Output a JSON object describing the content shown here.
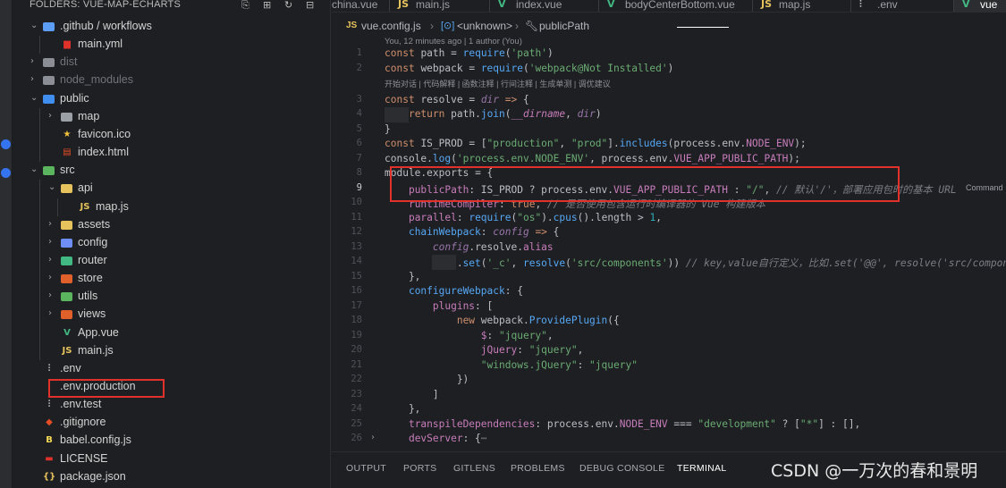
{
  "explorer": {
    "title": "FOLDERS: VUE-MAP-ECHARTS",
    "header_icons": [
      "new-file-icon",
      "new-folder-icon",
      "refresh-icon",
      "collapse-all-icon"
    ],
    "items": [
      {
        "label": ".github / workflows",
        "type": "folder",
        "open": true,
        "depth": 0,
        "dim": false
      },
      {
        "label": "main.yml",
        "type": "yml",
        "depth": 1,
        "dim": false
      },
      {
        "label": "dist",
        "type": "folder",
        "open": false,
        "depth": 0,
        "dim": true
      },
      {
        "label": "node_modules",
        "type": "folder",
        "open": false,
        "depth": 0,
        "dim": true
      },
      {
        "label": "public",
        "type": "folder",
        "open": true,
        "depth": 0,
        "dim": false
      },
      {
        "label": "map",
        "type": "folder",
        "open": false,
        "depth": 1,
        "dim": false
      },
      {
        "label": "favicon.ico",
        "type": "ico",
        "depth": 1,
        "dim": false
      },
      {
        "label": "index.html",
        "type": "html",
        "depth": 1,
        "dim": false
      },
      {
        "label": "src",
        "type": "folder",
        "open": true,
        "depth": 0,
        "dim": false
      },
      {
        "label": "api",
        "type": "folder",
        "open": true,
        "depth": 1,
        "dim": false
      },
      {
        "label": "map.js",
        "type": "js",
        "depth": 2,
        "dim": false
      },
      {
        "label": "assets",
        "type": "folder",
        "open": false,
        "depth": 1,
        "dim": false
      },
      {
        "label": "config",
        "type": "folder",
        "open": false,
        "depth": 1,
        "dim": false
      },
      {
        "label": "router",
        "type": "folder",
        "open": false,
        "depth": 1,
        "dim": false
      },
      {
        "label": "store",
        "type": "folder",
        "open": false,
        "depth": 1,
        "dim": false
      },
      {
        "label": "utils",
        "type": "folder",
        "open": false,
        "depth": 1,
        "dim": false
      },
      {
        "label": "views",
        "type": "folder",
        "open": false,
        "depth": 1,
        "dim": false
      },
      {
        "label": "App.vue",
        "type": "vue",
        "depth": 1,
        "dim": false
      },
      {
        "label": "main.js",
        "type": "js",
        "depth": 1,
        "dim": false
      },
      {
        "label": ".env",
        "type": "env",
        "depth": 0,
        "dim": false
      },
      {
        "label": ".env.production",
        "type": "env",
        "depth": 0,
        "dim": false
      },
      {
        "label": ".env.test",
        "type": "env",
        "depth": 0,
        "dim": false
      },
      {
        "label": ".gitignore",
        "type": "git",
        "depth": 0,
        "dim": false
      },
      {
        "label": "babel.config.js",
        "type": "babel",
        "depth": 0,
        "dim": false
      },
      {
        "label": "LICENSE",
        "type": "license",
        "depth": 0,
        "dim": false
      },
      {
        "label": "package.json",
        "type": "json",
        "depth": 0,
        "dim": false
      }
    ]
  },
  "tabs": [
    {
      "label": "china.vue",
      "icon": "vue-icon",
      "active": false
    },
    {
      "label": "main.js",
      "icon": "js-icon",
      "active": false
    },
    {
      "label": "index.vue",
      "icon": "vue-icon",
      "active": false
    },
    {
      "label": "bodyCenterBottom.vue",
      "icon": "vue-icon",
      "active": false
    },
    {
      "label": "map.js",
      "icon": "js-icon",
      "active": false
    },
    {
      "label": ".env",
      "icon": "env-icon",
      "active": false
    },
    {
      "label": "vue",
      "icon": "vue-icon",
      "active": true
    }
  ],
  "breadcrumb": {
    "file": "vue.config.js",
    "symbol1": "<unknown>",
    "symbol2": "publicPath"
  },
  "blame": "You, 12 minutes ago | 1 author (You)",
  "codelens": "开始对话 | 代码解释 | 函数注释 | 行间注释 | 生成单测 | 调优建议",
  "inline_hint": "Command",
  "current_line": 9,
  "line_numbers": [
    "1",
    "2",
    "3",
    "4",
    "5",
    "6",
    "7",
    "8",
    "9",
    "10",
    "11",
    "12",
    "13",
    "14",
    "15",
    "16",
    "17",
    "18",
    "19",
    "20",
    "21",
    "22",
    "23",
    "24",
    "25",
    "26"
  ],
  "panel_tabs": [
    {
      "label": "OUTPUT",
      "active": false
    },
    {
      "label": "PORTS",
      "active": false
    },
    {
      "label": "GITLENS",
      "active": false
    },
    {
      "label": "PROBLEMS",
      "active": false
    },
    {
      "label": "DEBUG CONSOLE",
      "active": false
    },
    {
      "label": "TERMINAL",
      "active": true
    }
  ],
  "watermark": "CSDN @一万次的春和景明",
  "colors": {
    "highlight_box": "#e0312b",
    "accent": "#3574f0"
  }
}
